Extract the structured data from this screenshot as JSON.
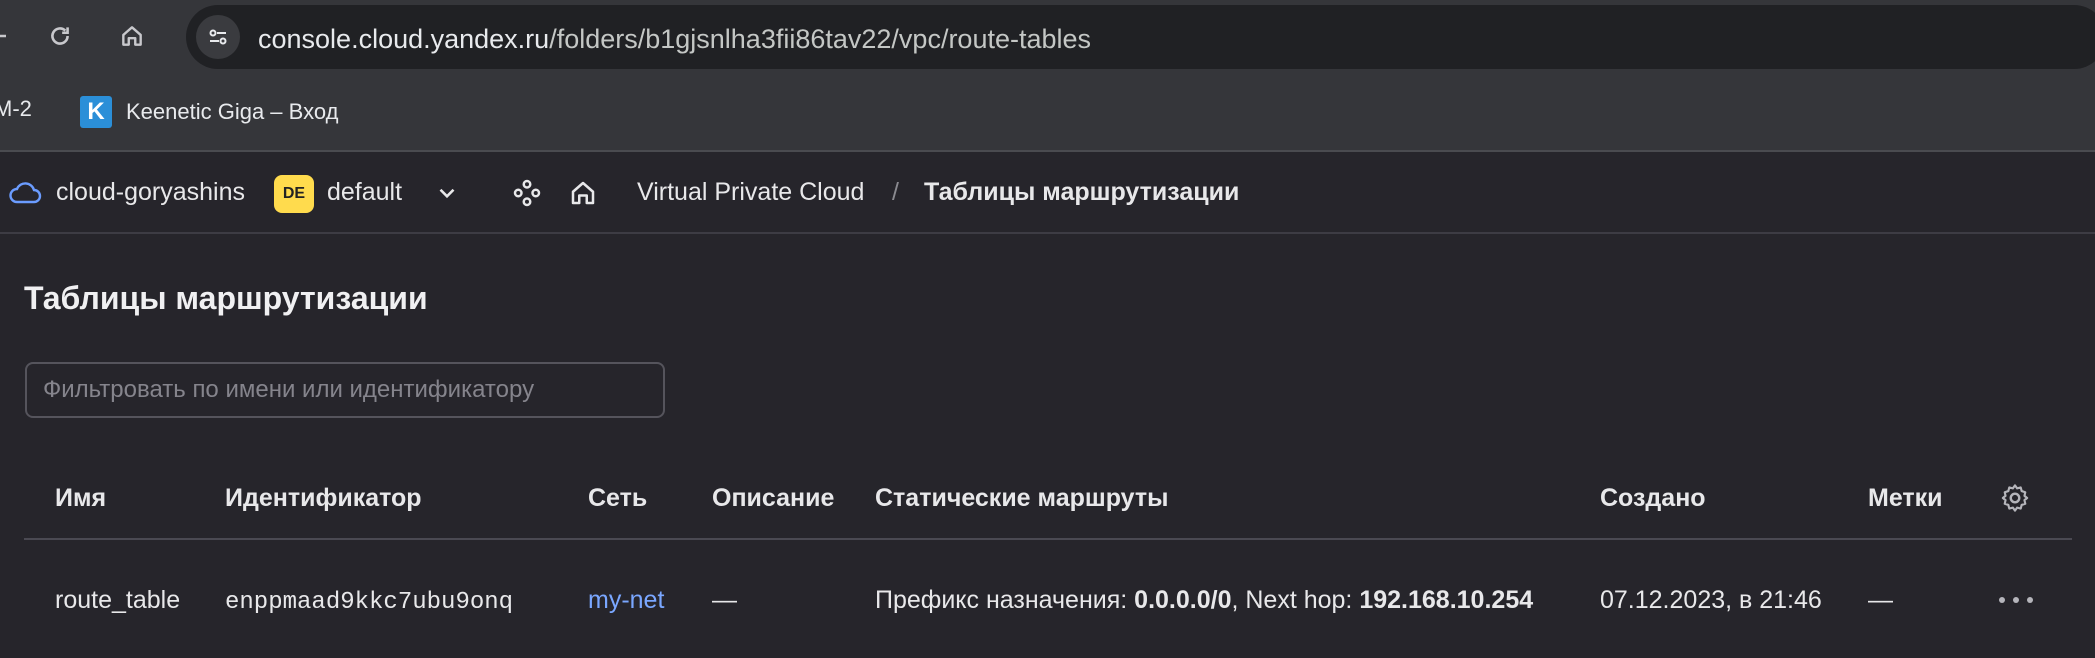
{
  "browser": {
    "url_host": "console.cloud.yandex.ru",
    "url_path": "/folders/b1gjsnlha3fii86tav22/vpc/route-tables"
  },
  "bookmarks": [
    {
      "label": "M-2"
    },
    {
      "label": "Keenetic Giga – Вход",
      "favicon_letter": "K"
    }
  ],
  "console_header": {
    "cloud": "cloud-goryashins",
    "folder_badge": "DE",
    "folder": "default",
    "breadcrumb": {
      "service": "Virtual Private Cloud",
      "separator": "/",
      "current": "Таблицы маршрутизации"
    }
  },
  "page": {
    "title": "Таблицы маршрутизации",
    "filter_placeholder": "Фильтровать по имени или идентификатору"
  },
  "table": {
    "columns": {
      "name": "Имя",
      "id": "Идентификатор",
      "network": "Сеть",
      "description": "Описание",
      "static_routes": "Статические маршруты",
      "created": "Создано",
      "labels": "Метки"
    },
    "rows": [
      {
        "name": "route_table",
        "id": "enppmaad9kkc7ubu9onq",
        "network": "my-net",
        "description": "—",
        "route_prefix_label": "Префикс назначения:",
        "route_prefix": "0.0.0.0/0",
        "route_nexthop_label": ", Next hop:",
        "route_nexthop": "192.168.10.254",
        "created": "07.12.2023, в 21:46",
        "labels": "—"
      }
    ]
  },
  "colors": {
    "background": "#26252b",
    "link": "#7aa7ff",
    "folder_badge": "#ffdb4d"
  }
}
